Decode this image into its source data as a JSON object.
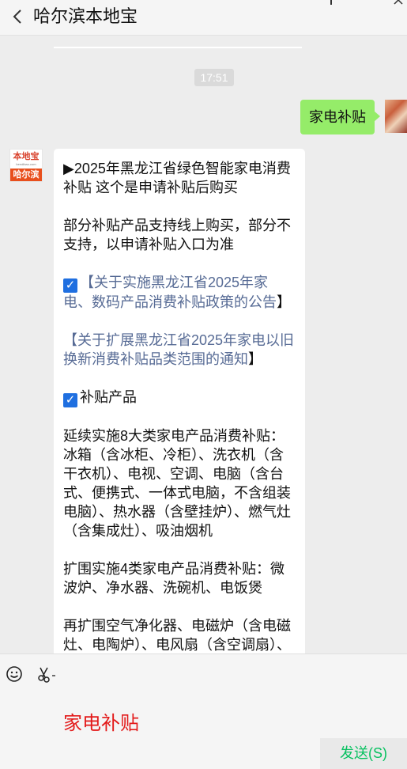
{
  "header": {
    "title": "哈尔滨本地宝"
  },
  "chat": {
    "timestamp": "17:51",
    "self_message": "家电补贴",
    "avatar": {
      "line1": "本地宝",
      "line2": "bendibao.com",
      "line3": "哈尔滨"
    },
    "incoming": {
      "p1": "▶2025年黑龙江省绿色智能家电消费补贴 这个是申请补贴后购买",
      "p2": "部分补贴产品支持线上购买，部分不支持，以申请补贴入口为准",
      "link1_label": "【关于实施黑龙江省2025年家电、数码产品消费补贴政策的公告】",
      "link1_open": "【",
      "link1_text": "关于实施黑龙江省2025年家电、数码产品消费补贴政策的公告",
      "link1_close": "】",
      "link2_open": "【",
      "link2_text": "关于扩展黑龙江省2025年家电以旧换新消费补贴品类范围的通知",
      "link2_close": "】",
      "p5": "补贴产品",
      "p6": "延续实施8大类家电产品消费补贴：冰箱（含冰柜、冷柜）、洗衣机（含干衣机）、电视、空调、电脑（含台式、便携式、一体式电脑，不含组装电脑）、热水器（含壁挂炉）、燃气灶（含集成灶）、吸油烟机",
      "p7": "扩围实施4类家电产品消费补贴：微波炉、净水器、洗碗机、电饭煲",
      "p8": "再扩围空气净化器、电磁炉（含电磁灶、电陶炉）、电风扇（含空调扇）、电压力锅、显示器（含显示"
    }
  },
  "composer": {
    "input_text": "家电补贴",
    "send_label": "发送(S)"
  },
  "icons": {
    "back": "chevron-left-icon",
    "emoji": "emoji-icon",
    "screenshot": "scissors-icon",
    "check": "check-icon"
  },
  "colors": {
    "self_bubble": "#95ec69",
    "link": "#576b95",
    "send_text": "#07c160",
    "input_text": "#e31b1b"
  }
}
